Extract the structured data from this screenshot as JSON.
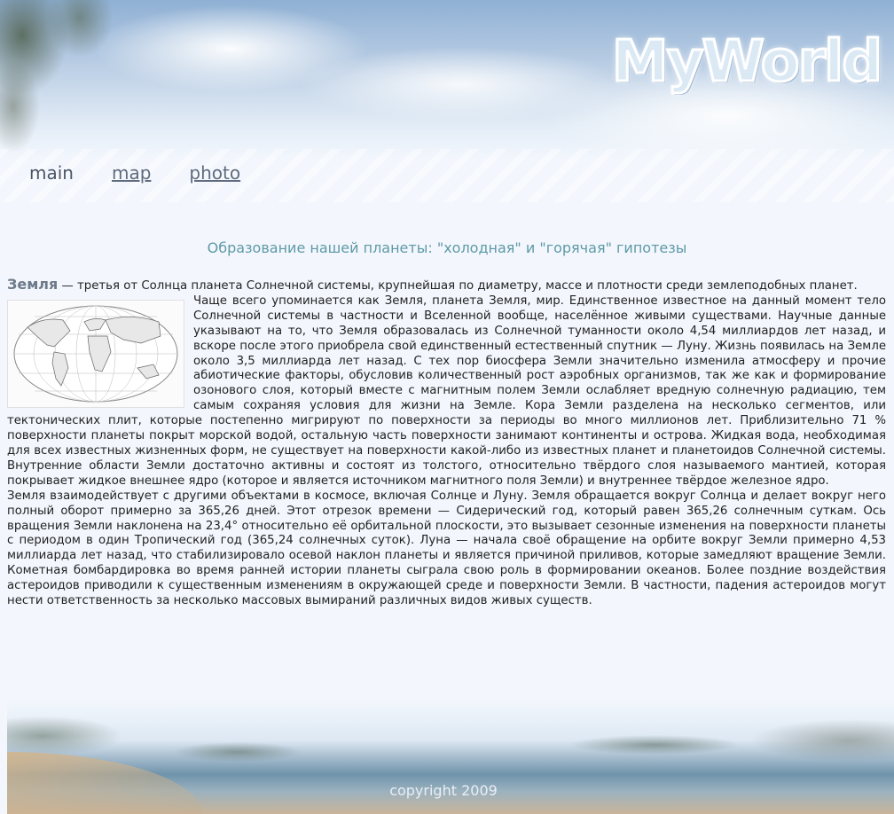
{
  "header": {
    "logo_text": "MyWorld"
  },
  "nav": [
    {
      "label": "main",
      "current": true
    },
    {
      "label": "map",
      "current": false
    },
    {
      "label": "photo",
      "current": false
    }
  ],
  "article": {
    "title": "Образование нашей планеты: \"холодная\" и \"горячая\" гипотезы",
    "lead_term": "Земля",
    "lead_rest": " — третья от Солнца планета Солнечной системы, крупнейшая по диаметру, массе и плотности среди землеподобных планет.",
    "para2": "Чаще всего упоминается как Земля, планета Земля, мир. Единственное известное на данный момент тело Солнечной системы в частности и Вселенной вообще, населённое живыми существами. Научные данные указывают на то, что Земля образовалась из Солнечной туманности около 4,54 миллиардов лет назад, и вскоре после этого приобрела свой единственный естественный спутник — Луну. Жизнь появилась на Земле около 3,5 миллиарда лет назад. С тех пор биосфера Земли значительно изменила атмосферу и прочие абиотические факторы, обусловив количественный рост аэробных организмов, так же как и формирование озонового слоя, который вместе с магнитным полем Земли ослабляет вредную солнечную радиацию, тем самым сохраняя условия для жизни на Земле. Кора Земли разделена на несколько сегментов, или тектонических плит, которые постепенно мигрируют по поверхности за периоды во много миллионов лет. Приблизительно 71 % поверхности планеты покрыт морской водой, остальную часть поверхности занимают континенты и острова. Жидкая вода, необходимая для всех известных жизненных форм, не существует на поверхности какой-либо из известных планет и планетоидов Солнечной системы. Внутренние области Земли достаточно активны и состоят из толстого, относительно твёрдого слоя называемого мантией, которая покрывает жидкое внешнее ядро (которое и является источником магнитного поля Земли) и внутреннее твёрдое железное ядро.",
    "para3": "Земля взаимодействует с другими объектами в космосе, включая Солнце и Луну. Земля обращается вокруг Солнца и делает вокруг него полный оборот примерно за 365,26 дней. Этот отрезок времени — Сидерический год, который равен 365,26 солнечным суткам. Ось вращения Земли наклонена на 23,4° относительно её орбитальной плоскости, это вызывает сезонные изменения на поверхности планеты с периодом в один Тропический год (365,24 солнечных суток). Луна — начала своё обращение на орбите вокруг Земли примерно 4,53 миллиарда лет назад, что стабилизировало осевой наклон планеты и является причиной приливов, которые замедляют вращение Земли. Кометная бомбардировка во время ранней истории планеты сыграла свою роль в формировании океанов. Более поздние воздействия астероидов приводили к существенным изменениям в окружающей среде и поверхности Земли. В частности, падения астероидов могут нести ответственность за несколько массовых вымираний различных видов живых существ."
  },
  "footer": {
    "copyright": "copyright 2009"
  }
}
